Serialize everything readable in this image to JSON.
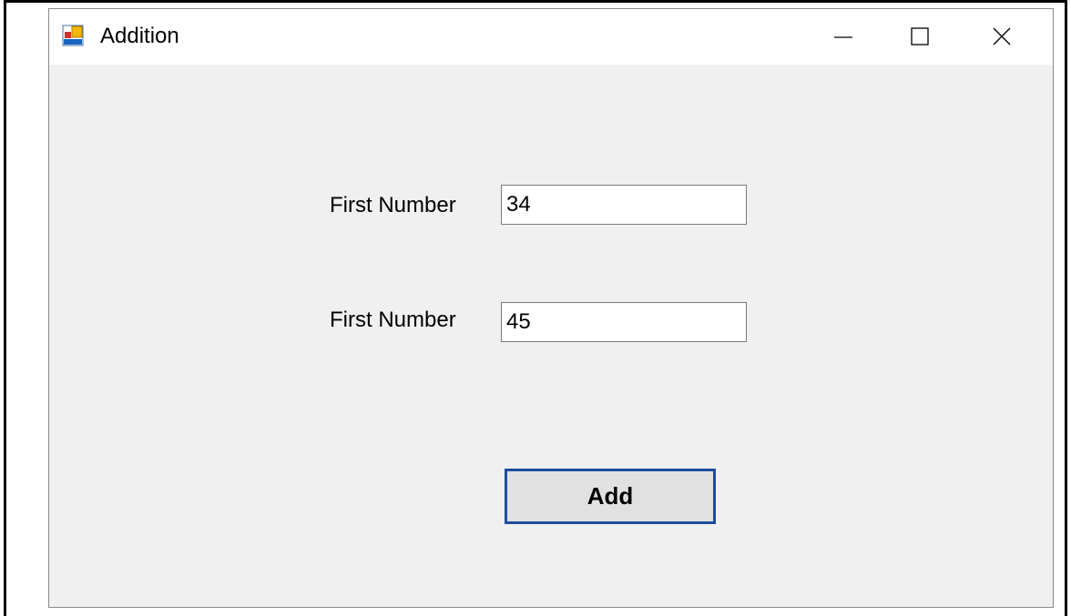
{
  "window": {
    "title": "Addition",
    "icon": "winforms-app-icon"
  },
  "titlebar_controls": {
    "minimize_icon": "minimize-icon",
    "maximize_icon": "maximize-icon",
    "close_icon": "close-icon"
  },
  "form": {
    "field1": {
      "label": "First Number",
      "value": "34"
    },
    "field2": {
      "label": "First Number",
      "value": "45"
    },
    "add_button_label": "Add"
  },
  "colors": {
    "button_border": "#1e4e9b",
    "form_background": "#f0f0f0"
  }
}
